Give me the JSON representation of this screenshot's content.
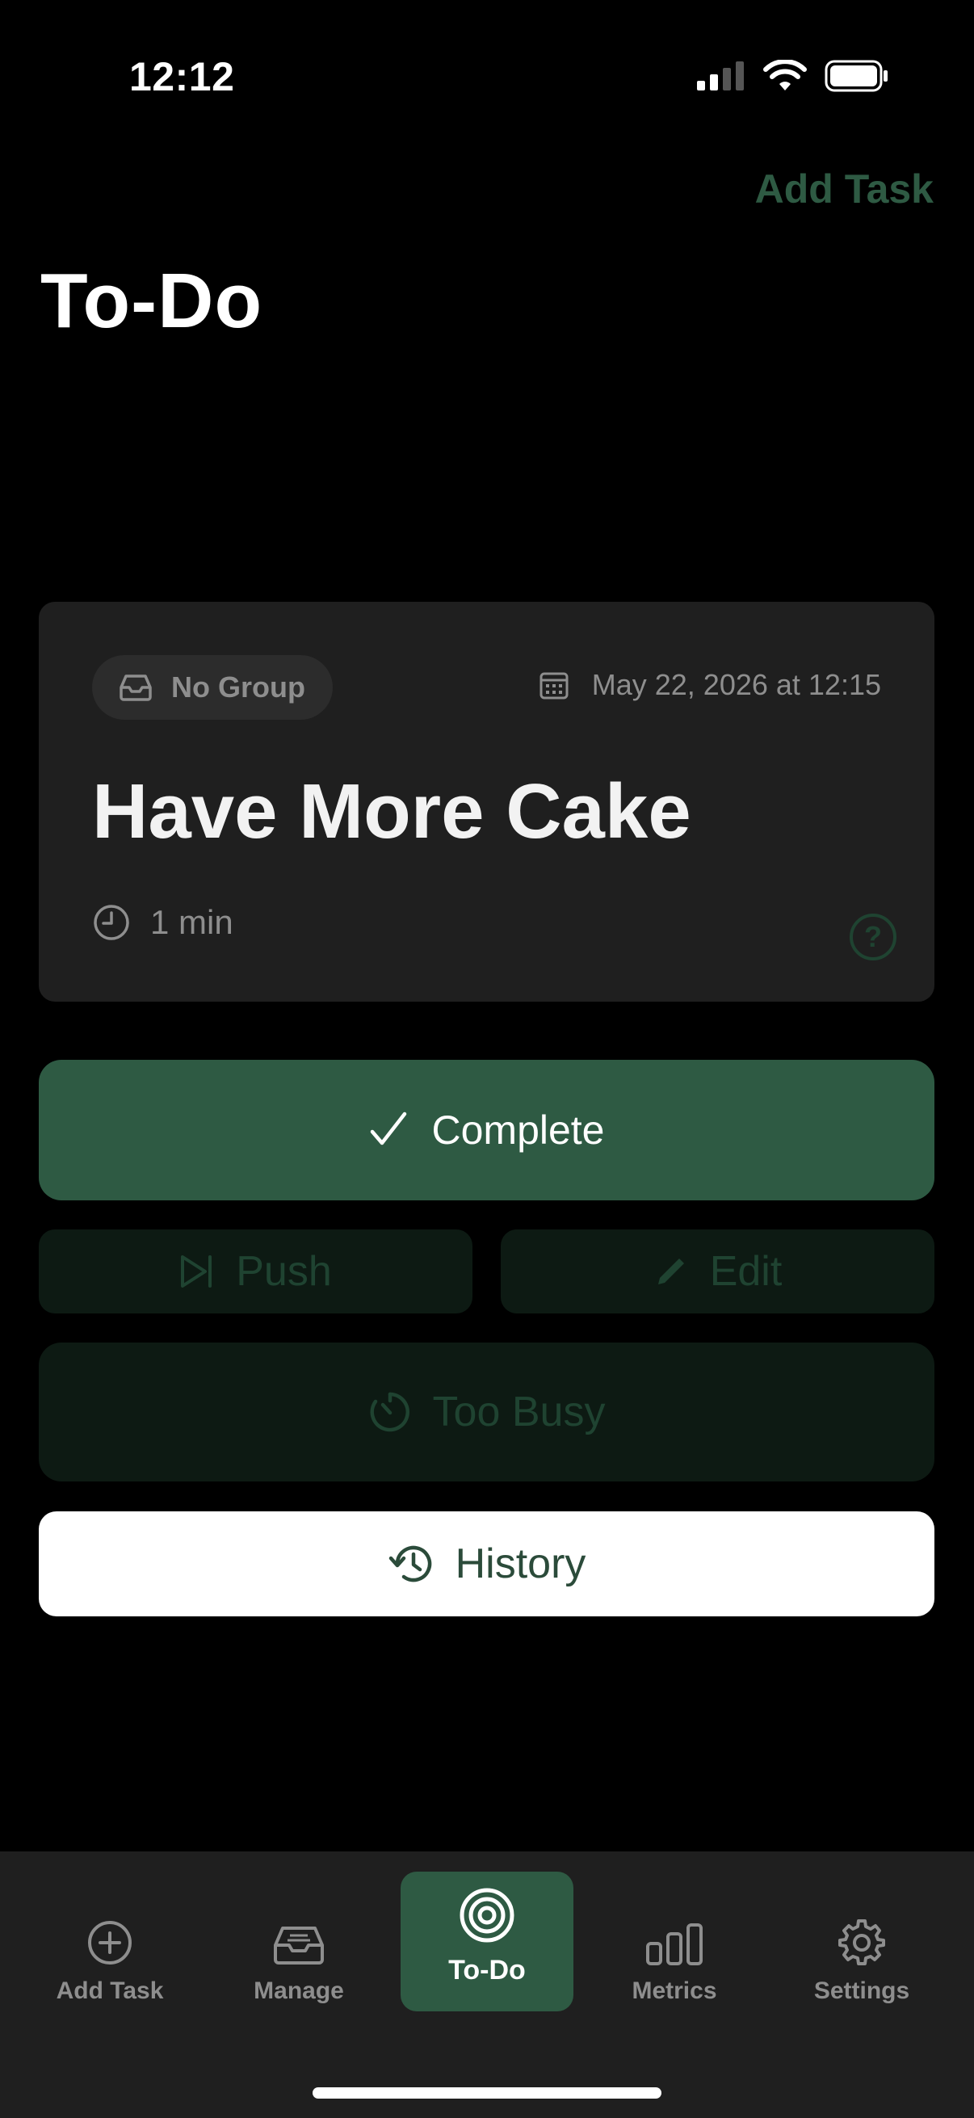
{
  "status_bar": {
    "time": "12:12"
  },
  "header": {
    "add_task_label": "Add Task",
    "title": "To-Do"
  },
  "task": {
    "group": "No Group",
    "date": "May 22, 2026 at 12:15",
    "title": "Have More Cake",
    "duration": "1 min"
  },
  "actions": {
    "complete": "Complete",
    "push": "Push",
    "edit": "Edit",
    "too_busy": "Too Busy",
    "history": "History"
  },
  "tabs": [
    {
      "label": "Add Task",
      "icon": "plus-circle-icon",
      "active": false
    },
    {
      "label": "Manage",
      "icon": "tray-icon",
      "active": false
    },
    {
      "label": "To-Do",
      "icon": "target-icon",
      "active": true
    },
    {
      "label": "Metrics",
      "icon": "bar-chart-icon",
      "active": false
    },
    {
      "label": "Settings",
      "icon": "gear-icon",
      "active": false
    }
  ],
  "colors": {
    "accent": "#2e5a43",
    "accent_dim": "#1f4331",
    "card": "#1f1f1f",
    "background": "#000000"
  }
}
